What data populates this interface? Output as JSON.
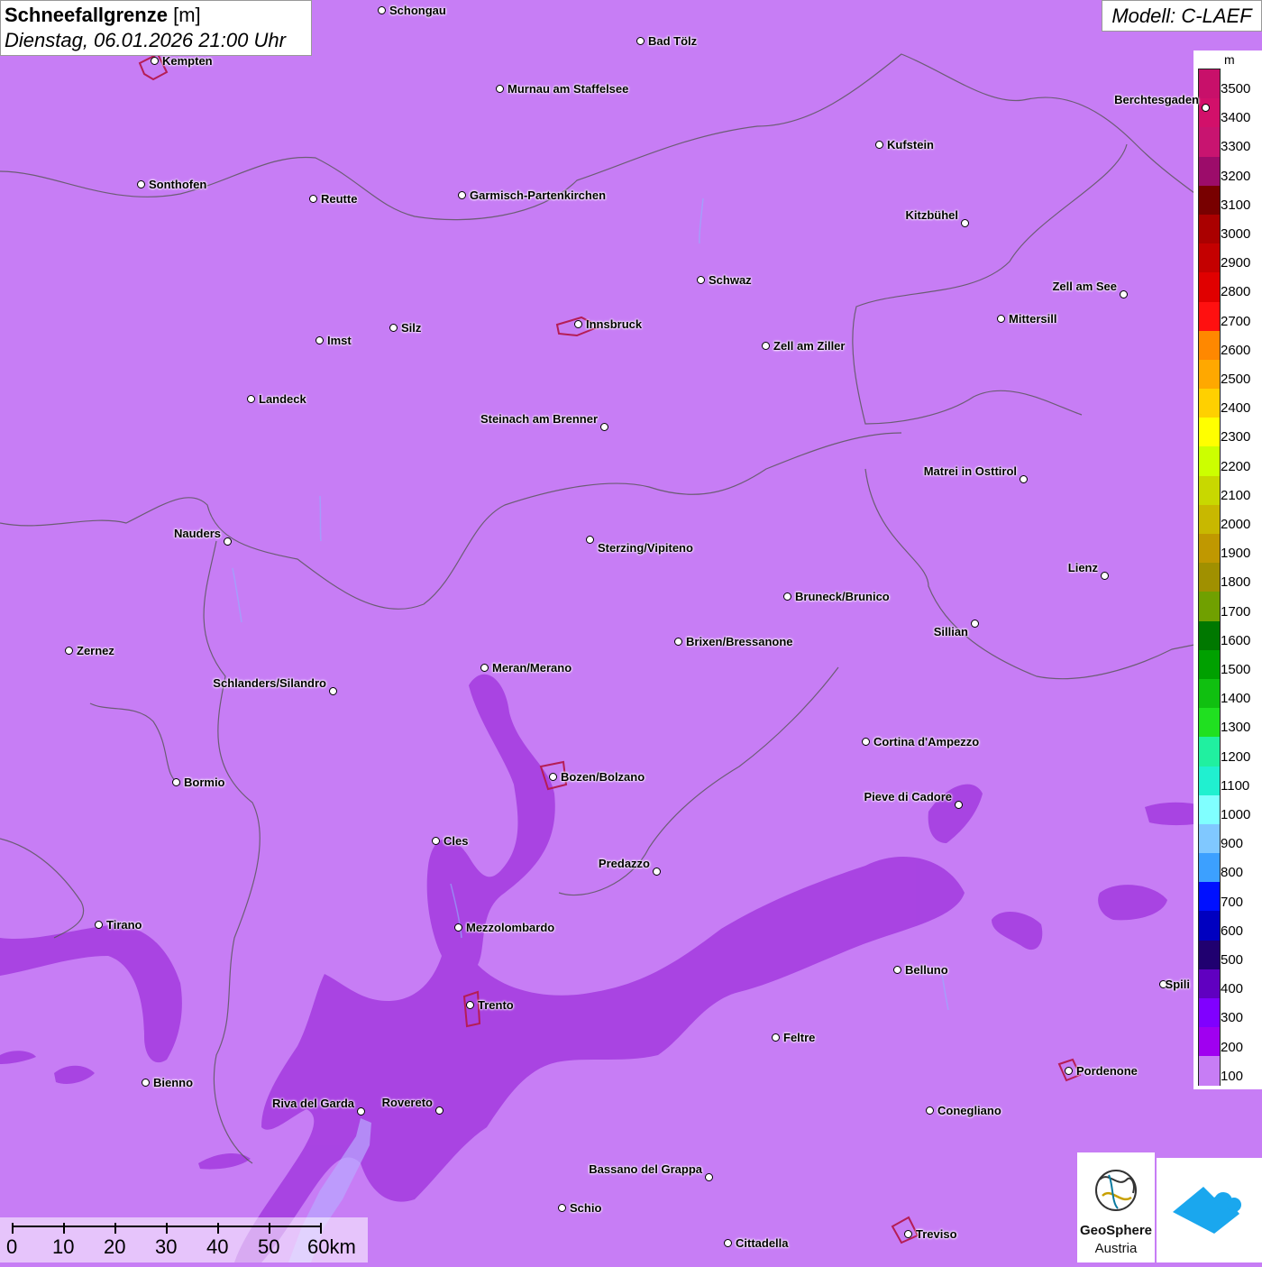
{
  "title": {
    "variable": "Schneefallgrenze",
    "unit": "[m]",
    "datetime": "Dienstag, 06.01.2026 21:00 Uhr"
  },
  "model_label": "Modell: C-LAEF",
  "legend": {
    "unit": "m",
    "labels": [
      "3500",
      "3400",
      "3300",
      "3200",
      "3100",
      "3000",
      "2900",
      "2800",
      "2700",
      "2600",
      "2500",
      "2400",
      "2300",
      "2200",
      "2100",
      "2000",
      "1900",
      "1800",
      "1700",
      "1600",
      "1500",
      "1400",
      "1300",
      "1200",
      "1100",
      "1000",
      "900",
      "800",
      "700",
      "600",
      "500",
      "400",
      "300",
      "200",
      "100"
    ],
    "colors": [
      "#c8106a",
      "#d2106a",
      "#c81470",
      "#9c0c6a",
      "#780000",
      "#aa0000",
      "#c40000",
      "#e00000",
      "#ff1010",
      "#ff8800",
      "#ffa800",
      "#ffd000",
      "#ffff00",
      "#ccff00",
      "#c8d800",
      "#c8b800",
      "#c09800",
      "#a09000",
      "#70a000",
      "#007800",
      "#00a000",
      "#10c010",
      "#20e020",
      "#20f0a0",
      "#20f0d0",
      "#80ffff",
      "#80c8ff",
      "#3ca0ff",
      "#0010ff",
      "#0000c0",
      "#200070",
      "#6000c0",
      "#8000ff",
      "#a000f0",
      "#c77df5"
    ]
  },
  "cities": [
    {
      "name": "Schongau"
    },
    {
      "name": "Bad Tölz"
    },
    {
      "name": "Kempten"
    },
    {
      "name": "Murnau am Staffelsee"
    },
    {
      "name": "Berchtesgaden"
    },
    {
      "name": "Kufstein"
    },
    {
      "name": "Sonthofen"
    },
    {
      "name": "Reutte"
    },
    {
      "name": "Garmisch-Partenkirchen"
    },
    {
      "name": "Kitzbühel"
    },
    {
      "name": "Schwaz"
    },
    {
      "name": "Zell am See"
    },
    {
      "name": "Mittersill"
    },
    {
      "name": "Innsbruck"
    },
    {
      "name": "Silz"
    },
    {
      "name": "Imst"
    },
    {
      "name": "Zell am Ziller"
    },
    {
      "name": "Landeck"
    },
    {
      "name": "Steinach am Brenner"
    },
    {
      "name": "Matrei in Osttirol"
    },
    {
      "name": "Nauders"
    },
    {
      "name": "Sterzing/Vipiteno"
    },
    {
      "name": "Lienz"
    },
    {
      "name": "Bruneck/Brunico"
    },
    {
      "name": "Sillian"
    },
    {
      "name": "Zernez"
    },
    {
      "name": "Brixen/Bressanone"
    },
    {
      "name": "Meran/Merano"
    },
    {
      "name": "Schlanders/Silandro"
    },
    {
      "name": "Cortina d'Ampezzo"
    },
    {
      "name": "Bormio"
    },
    {
      "name": "Bozen/Bolzano"
    },
    {
      "name": "Pieve di Cadore"
    },
    {
      "name": "Cles"
    },
    {
      "name": "Predazzo"
    },
    {
      "name": "Tirano"
    },
    {
      "name": "Mezzolombardo"
    },
    {
      "name": "Belluno"
    },
    {
      "name": "Spili"
    },
    {
      "name": "Trento"
    },
    {
      "name": "Feltre"
    },
    {
      "name": "Bienno"
    },
    {
      "name": "Pordenone"
    },
    {
      "name": "Riva del Garda"
    },
    {
      "name": "Rovereto"
    },
    {
      "name": "Conegliano"
    },
    {
      "name": "Bassano del Grappa"
    },
    {
      "name": "Schio"
    },
    {
      "name": "Treviso"
    },
    {
      "name": "Cittadella"
    }
  ],
  "scale_bar": {
    "labels": [
      "0",
      "10",
      "20",
      "30",
      "40",
      "50",
      "60km"
    ]
  },
  "logos": {
    "geosphere_line1": "GeoSphere",
    "geosphere_line2": "Austria"
  }
}
